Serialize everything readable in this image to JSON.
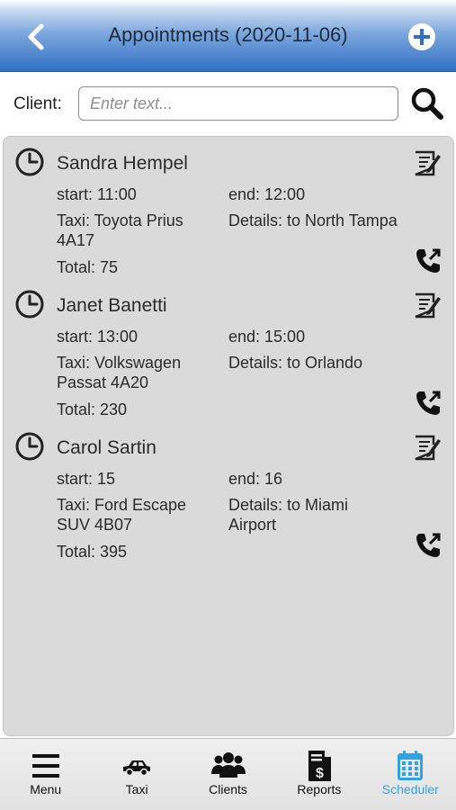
{
  "header": {
    "title": "Appointments (2020-11-06)",
    "back_icon": "chevron-left-icon",
    "add_icon": "plus-circle-icon"
  },
  "search": {
    "label": "Client:",
    "placeholder": "Enter text...",
    "value": "",
    "icon": "search-icon"
  },
  "appointments": [
    {
      "name": "Sandra Hempel",
      "start": "start: 11:00",
      "end": "end: 12:00",
      "taxi": "Taxi: Toyota Prius 4A17",
      "details": "Details: to North Tampa",
      "total": "Total: 75"
    },
    {
      "name": "Janet Banetti",
      "start": "start: 13:00",
      "end": "end: 15:00",
      "taxi": "Taxi: Volkswagen Passat 4A20",
      "details": "Details: to Orlando",
      "total": "Total: 230"
    },
    {
      "name": "Carol Sartin",
      "start": "start: 15",
      "end": "end: 16",
      "taxi": "Taxi: Ford Escape SUV 4B07",
      "details": "Details: to Miami Airport",
      "total": "Total: 395"
    }
  ],
  "nav": {
    "items": [
      {
        "label": "Menu",
        "icon": "hamburger-icon"
      },
      {
        "label": "Taxi",
        "icon": "car-icon"
      },
      {
        "label": "Clients",
        "icon": "users-icon"
      },
      {
        "label": "Reports",
        "icon": "report-icon"
      },
      {
        "label": "Scheduler",
        "icon": "calendar-icon"
      }
    ],
    "active": "Scheduler"
  },
  "colors": {
    "header_top": "#ffffff",
    "header_bottom": "#2f6fc4",
    "panel_bg": "#dadada",
    "active_nav": "#2ea3e3"
  }
}
